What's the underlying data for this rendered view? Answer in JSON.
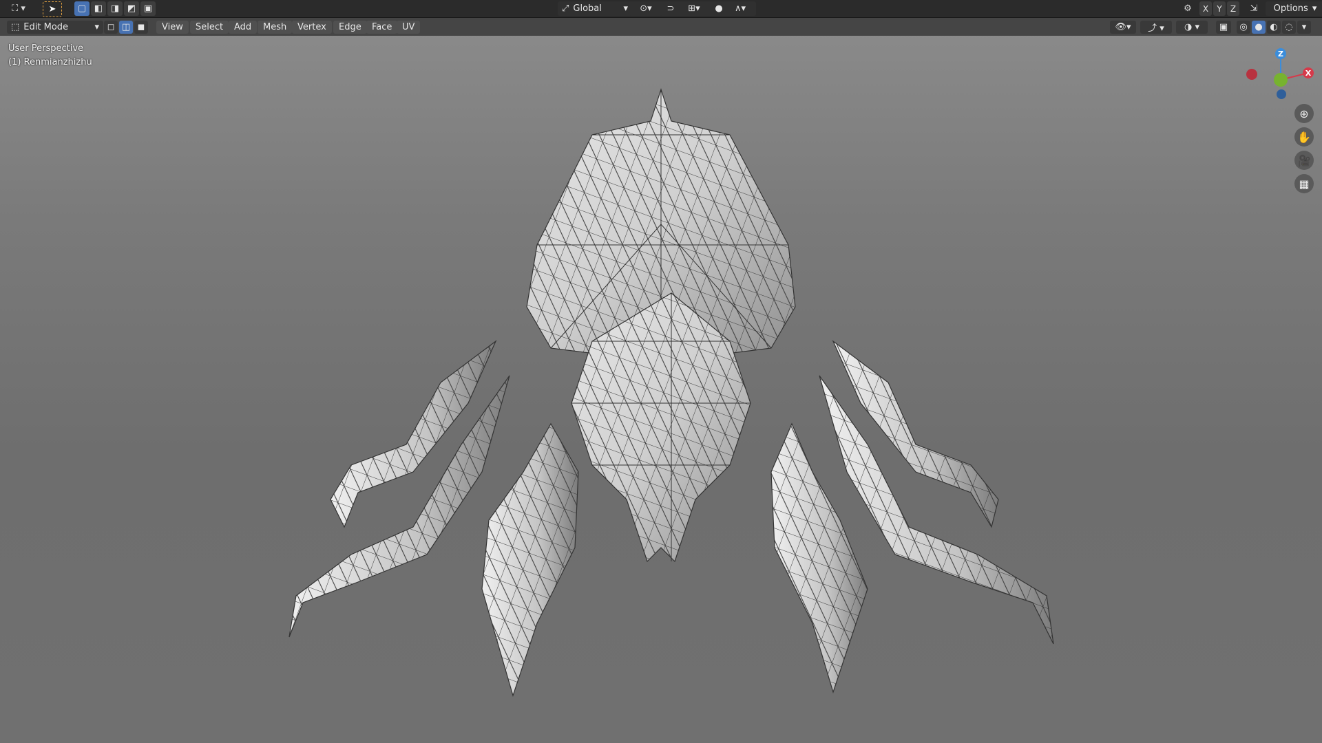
{
  "topbar": {
    "icons": [
      "editor-type-icon",
      "tweak-tool-icon",
      "box-select-icon",
      "mode-select-icon"
    ],
    "orientation_label": "Global",
    "axes": [
      "X",
      "Y",
      "Z"
    ],
    "options_label": "Options"
  },
  "header": {
    "mode_label": "Edit Mode",
    "menus": [
      "View",
      "Select",
      "Add",
      "Mesh",
      "Vertex",
      "Edge",
      "Face",
      "UV"
    ]
  },
  "viewport": {
    "perspective_label": "User Perspective",
    "object_label": "(1) Renmianzhizhu",
    "gizmo": {
      "z": "Z",
      "y": "Y",
      "x": "X"
    }
  },
  "colors": {
    "viewport_top": "#8b8b8b",
    "viewport_bottom": "#707070",
    "accent": "#4772b3",
    "axis_x": "#d63a4a",
    "axis_y": "#77b32f",
    "axis_z": "#3b8ddb"
  }
}
